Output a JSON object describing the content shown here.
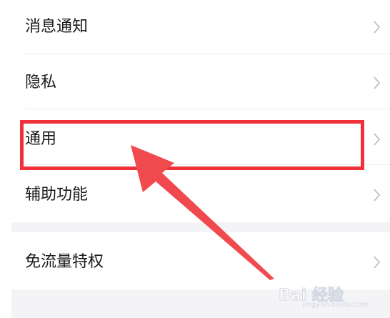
{
  "settings": {
    "items": [
      {
        "label": "消息通知",
        "icon": "chevron-right-icon"
      },
      {
        "label": "隐私",
        "icon": "chevron-right-icon"
      },
      {
        "label": "通用",
        "icon": "chevron-right-icon"
      },
      {
        "label": "辅助功能",
        "icon": "chevron-right-icon"
      },
      {
        "label": "免流量特权",
        "icon": "chevron-right-icon"
      }
    ]
  },
  "annotation": {
    "highlight_color": "#f0313a",
    "arrow_color": "#f04a4f"
  },
  "watermark": {
    "line1": "Bai 经验",
    "line2": "jingyan.baidu.com"
  },
  "colors": {
    "text": "#1a1a1a",
    "chevron": "#b8b8bd",
    "divider": "#eeeeee",
    "section_gap": "#f4f4f6"
  }
}
